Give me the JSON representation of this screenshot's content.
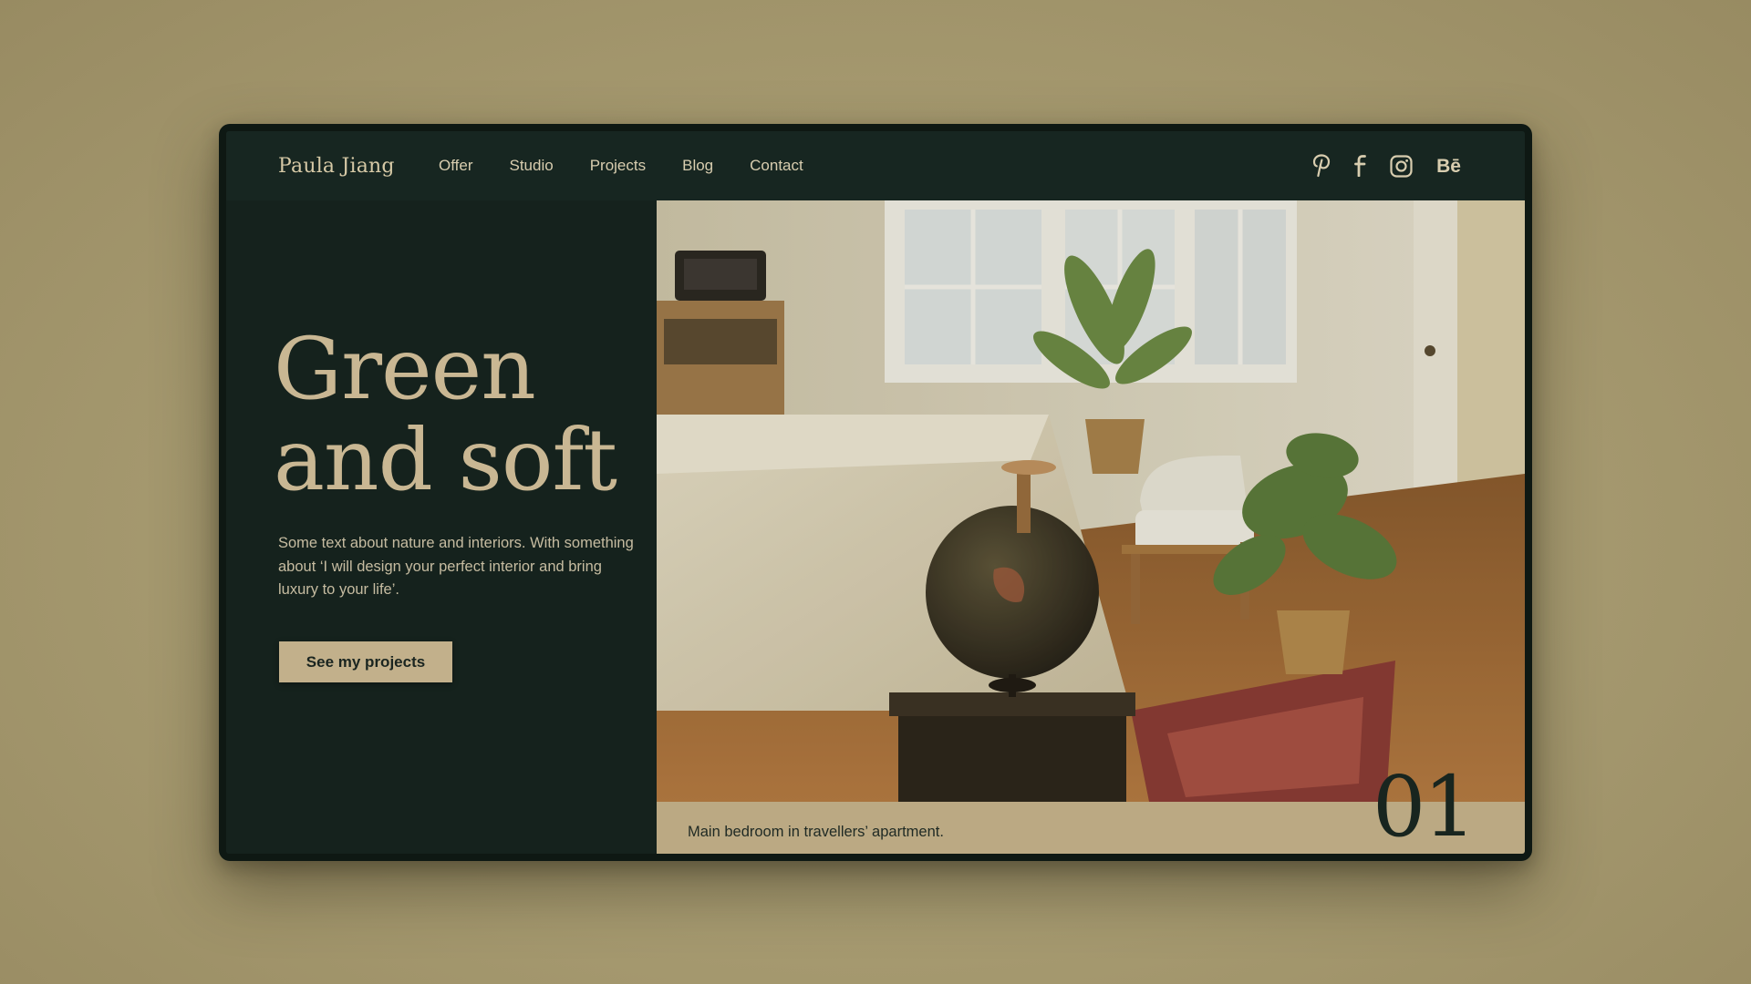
{
  "header": {
    "brand": "Paula Jiang",
    "nav": [
      "Offer",
      "Studio",
      "Projects",
      "Blog",
      "Contact"
    ],
    "social": [
      "pinterest-icon",
      "facebook-icon",
      "instagram-icon",
      "behance-icon"
    ],
    "behance_label": "Bē"
  },
  "hero": {
    "headline_line1": "Green",
    "headline_line2": "and soft",
    "description": "Some text about nature and interiors. With something about ‘I will design your perfect interior and bring luxury to your life’.",
    "cta_label": "See my projects"
  },
  "slide": {
    "caption": "Main bedroom in travellers’ apartment.",
    "number": "01"
  },
  "colors": {
    "panel": "#15221d",
    "accent": "#c2b08b",
    "caption_bar": "#bba983",
    "page_background": "#a89c72"
  }
}
